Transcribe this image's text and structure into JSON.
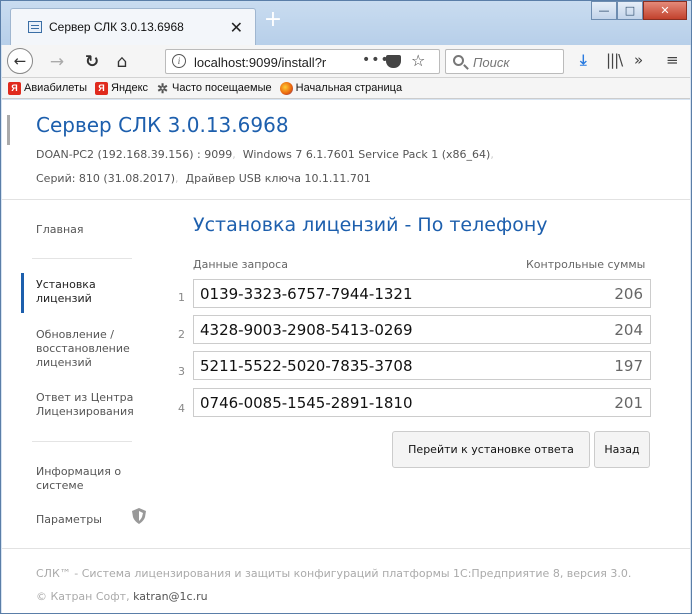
{
  "browser": {
    "tab_title": "Сервер СЛК 3.0.13.6968",
    "tab_close": "✕",
    "new_tab": "+",
    "url": "localhost:9099/install?r",
    "url_more": "•••",
    "search_placeholder": "Поиск",
    "bookmarks": [
      {
        "label": "Авиабилеты",
        "icon": "yandex-icon"
      },
      {
        "label": "Яндекс",
        "icon": "yandex-icon"
      },
      {
        "label": "Часто посещаемые",
        "icon": "gear-icon"
      },
      {
        "label": "Начальная страница",
        "icon": "firefox-icon"
      }
    ]
  },
  "server": {
    "title": "Сервер СЛК 3.0.13.6968",
    "host": "DOAN-PC2 (192.168.39.156) : 9099",
    "os": "Windows 7 6.1.7601 Service Pack 1 (x86_64)",
    "series": "Серий: 810 (31.08.2017)",
    "driver": "Драйвер USB ключа 10.1.11.701",
    "separator": ","
  },
  "sidebar": {
    "items": [
      {
        "label": "Главная"
      },
      {
        "label": "Установка лицензий",
        "active": true
      },
      {
        "label": "Обновление / восстановление лицензий"
      },
      {
        "label": "Ответ из Центра Лицензирования"
      },
      {
        "label": "Информация о системе"
      },
      {
        "label": "Параметры"
      }
    ]
  },
  "main": {
    "title": "Установка лицензий - По телефону",
    "col_request": "Данные запроса",
    "col_checksums": "Контрольные суммы",
    "rows": [
      {
        "num": "1",
        "code": "0139-3323-6757-7944-1321",
        "sum": "206"
      },
      {
        "num": "2",
        "code": "4328-9003-2908-5413-0269",
        "sum": "204"
      },
      {
        "num": "3",
        "code": "5211-5522-5020-7835-3708",
        "sum": "197"
      },
      {
        "num": "4",
        "code": "0746-0085-1545-2891-1810",
        "sum": "201"
      }
    ],
    "btn_goto": "Перейти к установке ответа",
    "btn_back": "Назад"
  },
  "footer": {
    "line1": "СЛК™ - Система лицензирования и защиты конфигураций платформы 1С:Предприятие 8, версия 3.0.",
    "copyright": "© Катран Софт,",
    "email": "katran@1c.ru"
  }
}
